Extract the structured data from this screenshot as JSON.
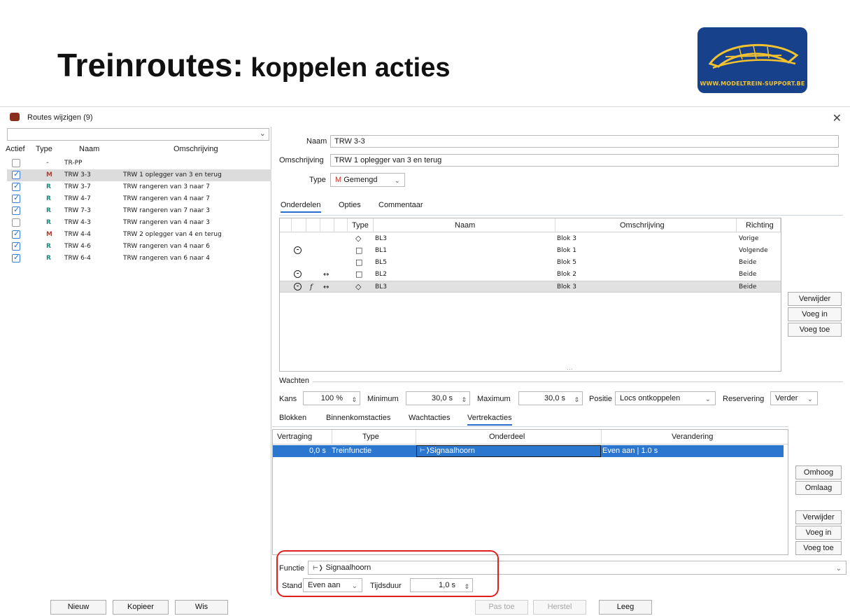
{
  "slide": {
    "title_main": "Treinroutes:",
    "title_sub": " koppelen acties",
    "logo_text": "WWW.MODELTREIN-SUPPORT.BE"
  },
  "window": {
    "title": "Routes wijzigen (9)",
    "close_icon": "✕"
  },
  "route_list": {
    "headers": {
      "actief": "Actief",
      "type": "Type",
      "naam": "Naam",
      "omschrijving": "Omschrijving"
    },
    "rows": [
      {
        "checked": false,
        "type": "-",
        "naam": "TR-PP",
        "omschrijving": "",
        "type_color": "#888888",
        "selected": false
      },
      {
        "checked": true,
        "type": "M",
        "naam": "TRW 3-3",
        "omschrijving": "TRW 1 oplegger van 3 en terug",
        "type_color": "#c0392b",
        "selected": true
      },
      {
        "checked": true,
        "type": "R",
        "naam": "TRW 3-7",
        "omschrijving": "TRW rangeren van 3 naar 7",
        "type_color": "#1a8a7a",
        "selected": false
      },
      {
        "checked": true,
        "type": "R",
        "naam": "TRW 4-7",
        "omschrijving": "TRW rangeren van 4 naar 7",
        "type_color": "#1a8a7a",
        "selected": false
      },
      {
        "checked": true,
        "type": "R",
        "naam": "TRW 7-3",
        "omschrijving": "TRW rangeren van 7 naar 3",
        "type_color": "#1a8a7a",
        "selected": false
      },
      {
        "checked": false,
        "type": "R",
        "naam": "TRW 4-3",
        "omschrijving": "TRW rangeren van 4 naar 3",
        "type_color": "#1a8a7a",
        "selected": false
      },
      {
        "checked": true,
        "type": "M",
        "naam": "TRW 4-4",
        "omschrijving": "TRW 2 oplegger van 4 en terug",
        "type_color": "#c0392b",
        "selected": false
      },
      {
        "checked": true,
        "type": "R",
        "naam": "TRW 4-6",
        "omschrijving": "TRW rangeren van 4 naar 6",
        "type_color": "#1a8a7a",
        "selected": false
      },
      {
        "checked": true,
        "type": "R",
        "naam": "TRW 6-4",
        "omschrijving": "TRW rangeren van 6 naar 4",
        "type_color": "#1a8a7a",
        "selected": false
      }
    ],
    "buttons": {
      "nieuw": "Nieuw",
      "kopieer": "Kopieer",
      "wis": "Wis"
    }
  },
  "form": {
    "naam_label": "Naam",
    "naam_value": "TRW 3-3",
    "omschrijving_label": "Omschrijving",
    "omschrijving_value": "TRW 1 oplegger van 3 en terug",
    "type_label": "Type",
    "type_letter": "M",
    "type_value": "Gemengd"
  },
  "tabs_top": [
    "Onderdelen",
    "Opties",
    "Commentaar"
  ],
  "parts_table": {
    "headers": {
      "type": "Type",
      "naam": "Naam",
      "omschrijving": "Omschrijving",
      "richting": "Richting"
    },
    "rows": [
      {
        "clock": false,
        "func": "",
        "arrow": "",
        "type_icon": "◇",
        "naam": "BL3",
        "omschrijving": "Blok 3",
        "richting": "Vorige",
        "selected": false
      },
      {
        "clock": true,
        "func": "",
        "arrow": "",
        "type_icon": "□",
        "naam": "BL1",
        "omschrijving": "Blok 1",
        "richting": "Volgende",
        "selected": false
      },
      {
        "clock": false,
        "func": "",
        "arrow": "",
        "type_icon": "□",
        "naam": "BL5",
        "omschrijving": "Blok 5",
        "richting": "Beide",
        "selected": false
      },
      {
        "clock": true,
        "func": "",
        "arrow": "↔",
        "type_icon": "□",
        "naam": "BL2",
        "omschrijving": "Blok 2",
        "richting": "Beide",
        "selected": false
      },
      {
        "clock": true,
        "func": "f",
        "arrow": "↔",
        "type_icon": "◇",
        "naam": "BL3",
        "omschrijving": "Blok 3",
        "richting": "Beide",
        "selected": true
      }
    ],
    "buttons": {
      "verwijder": "Verwijder",
      "voeg_in": "Voeg in",
      "voeg_toe": "Voeg toe"
    }
  },
  "wachten": {
    "title": "Wachten",
    "kans_label": "Kans",
    "kans_value": "100 %",
    "minimum_label": "Minimum",
    "minimum_value": "30,0 s",
    "maximum_label": "Maximum",
    "maximum_value": "30,0 s",
    "positie_label": "Positie",
    "positie_value": "Locs ontkoppelen",
    "reservering_label": "Reservering",
    "reservering_value": "Verder"
  },
  "tabs_actions": [
    "Blokken",
    "Binnenkomstacties",
    "Wachtacties",
    "Vertrekacties"
  ],
  "actions_table": {
    "headers": {
      "vertraging": "Vertraging",
      "type": "Type",
      "onderdeel": "Onderdeel",
      "verandering": "Verandering"
    },
    "row": {
      "vertraging": "0,0 s",
      "type": "Treinfunctie",
      "onderdeel": "Signaalhoorn",
      "verandering": "Even aan | 1.0 s"
    },
    "buttons": {
      "omhoog": "Omhoog",
      "omlaag": "Omlaag",
      "verwijder": "Verwijder",
      "voeg_in": "Voeg in",
      "voeg_toe": "Voeg toe"
    }
  },
  "functie": {
    "label": "Functie",
    "value": "Signaalhoorn",
    "icon": "horn-icon",
    "stand_label": "Stand",
    "stand_value": "Even aan",
    "tijdsduur_label": "Tijdsduur",
    "tijdsduur_value": "1,0 s"
  },
  "bottom_buttons": {
    "pas_toe": "Pas toe",
    "herstel": "Herstel",
    "leeg": "Leeg"
  },
  "colors": {
    "selection": "#2b77d0",
    "highlight": "#e02020",
    "logo_bg": "#17418a"
  }
}
